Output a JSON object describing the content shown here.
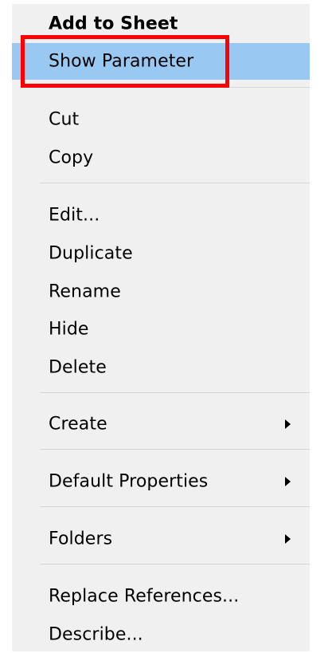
{
  "menu": {
    "add_to_sheet": "Add to Sheet",
    "show_parameter": "Show Parameter",
    "cut": "Cut",
    "copy": "Copy",
    "edit": "Edit...",
    "duplicate": "Duplicate",
    "rename": "Rename",
    "hide": "Hide",
    "delete": "Delete",
    "create": "Create",
    "default_properties": "Default Properties",
    "folders": "Folders",
    "replace_references": "Replace References...",
    "describe": "Describe..."
  },
  "colors": {
    "menu_background": "#f0f0f0",
    "selected_background": "#99c9f3",
    "highlight_border": "#ff0000"
  }
}
